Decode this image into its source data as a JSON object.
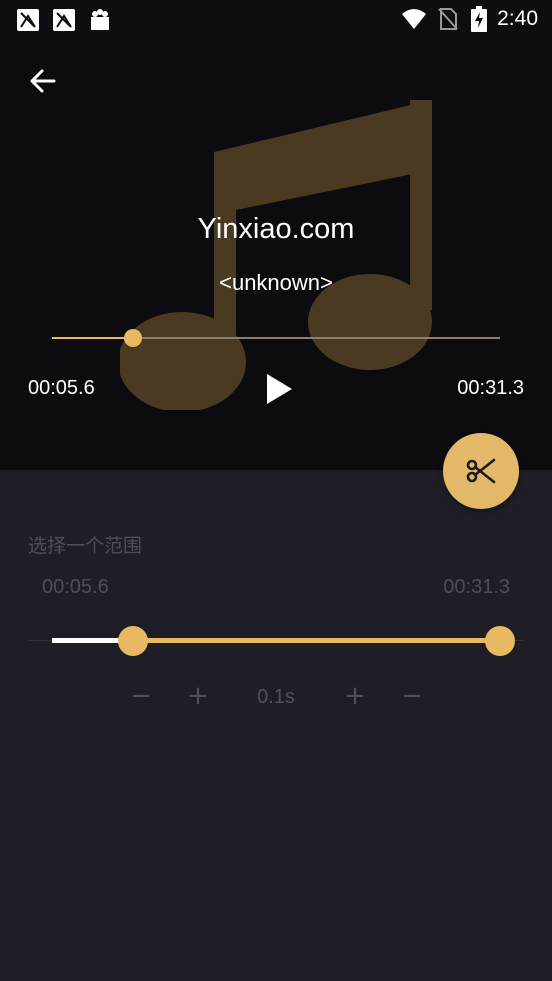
{
  "status_bar": {
    "time": "2:40",
    "left_icons": [
      "notification-app-icon",
      "notification-app-icon",
      "notification-shop-icon"
    ],
    "right_icons": [
      "wifi-icon",
      "no-sim-icon",
      "battery-charging-icon"
    ]
  },
  "player": {
    "title": "Yinxiao.com",
    "artist": "<unknown>",
    "current_time": "00:05.6",
    "total_time": "00:31.3",
    "progress": 0.18,
    "icons": {
      "back": "arrow-left-icon",
      "play": "play-icon",
      "art": "music-note-icon",
      "cut": "scissors-icon"
    }
  },
  "range": {
    "label": "选择一个范围",
    "start_time": "00:05.6",
    "end_time": "00:31.3",
    "start_fraction": 0.18,
    "end_fraction": 1.0,
    "step_label": "0.1s",
    "buttons": {
      "start_minus": "−",
      "start_plus": "+",
      "end_plus": "+",
      "end_minus": "−"
    }
  },
  "colors": {
    "accent": "#e8b862",
    "background": "#1e1e27",
    "player_background": "#0c0b10",
    "muted_text": "#4e4e58"
  }
}
